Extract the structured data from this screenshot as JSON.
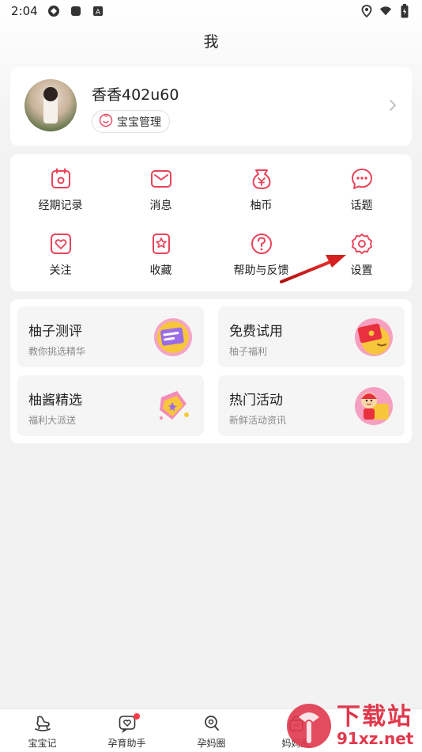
{
  "status_bar": {
    "time": "2:04"
  },
  "header": {
    "title": "我"
  },
  "profile": {
    "username": "香香402u60",
    "baby_manage_label": "宝宝管理"
  },
  "menu": {
    "items": [
      {
        "label": "经期记录",
        "icon": "calendar-icon"
      },
      {
        "label": "消息",
        "icon": "mail-icon"
      },
      {
        "label": "柚币",
        "icon": "coin-pouch-icon"
      },
      {
        "label": "话题",
        "icon": "chat-bubble-icon"
      },
      {
        "label": "关注",
        "icon": "heart-icon"
      },
      {
        "label": "收藏",
        "icon": "star-bookmark-icon"
      },
      {
        "label": "帮助与反馈",
        "icon": "question-icon"
      },
      {
        "label": "设置",
        "icon": "gear-icon"
      }
    ]
  },
  "promos": [
    {
      "title": "柚子测评",
      "subtitle": "教你挑选精华"
    },
    {
      "title": "免费试用",
      "subtitle": "柚子福利"
    },
    {
      "title": "柚酱精选",
      "subtitle": "福利大派送"
    },
    {
      "title": "热门活动",
      "subtitle": "新鲜活动资讯"
    }
  ],
  "bottom_nav": {
    "items": [
      {
        "label": "宝宝记"
      },
      {
        "label": "孕育助手"
      },
      {
        "label": "孕妈圈"
      },
      {
        "label": "妈妈圈"
      }
    ]
  },
  "watermark": {
    "cn": "下载站",
    "url": "91xz.net"
  },
  "colors": {
    "accent": "#e8445a",
    "annotation_arrow": "#d62020"
  }
}
